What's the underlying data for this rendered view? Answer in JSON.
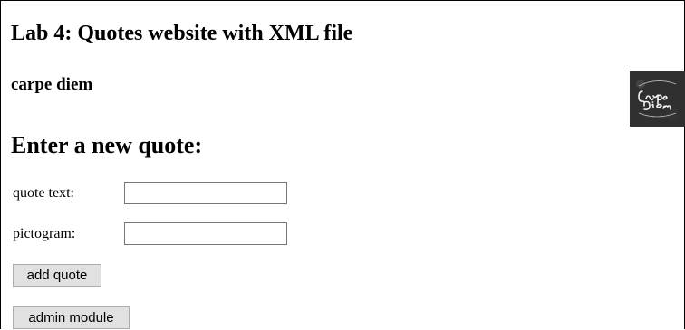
{
  "page": {
    "title": "Lab 4: Quotes website with XML file",
    "current_quote": "carpe diem",
    "pictogram_alt": "Carpe Diem",
    "form_title": "Enter a new quote:"
  },
  "form": {
    "quote_label": "quote text:",
    "quote_value": "",
    "pictogram_label": "pictogram:",
    "pictogram_value": ""
  },
  "buttons": {
    "add_quote": "add quote",
    "admin_module": "admin module"
  }
}
